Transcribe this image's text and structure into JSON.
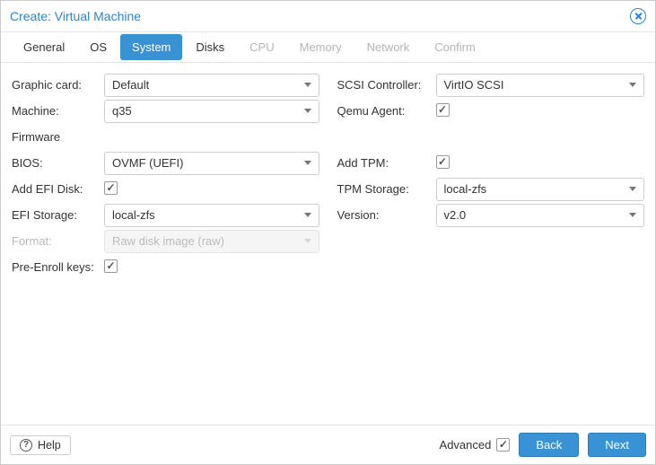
{
  "window": {
    "title": "Create: Virtual Machine"
  },
  "tabs": {
    "general": "General",
    "os": "OS",
    "system": "System",
    "disks": "Disks",
    "cpu": "CPU",
    "memory": "Memory",
    "network": "Network",
    "confirm": "Confirm"
  },
  "labels": {
    "graphic_card": "Graphic card:",
    "machine": "Machine:",
    "firmware": "Firmware",
    "bios": "BIOS:",
    "add_efi_disk": "Add EFI Disk:",
    "efi_storage": "EFI Storage:",
    "format": "Format:",
    "pre_enroll": "Pre-Enroll keys:",
    "scsi_controller": "SCSI Controller:",
    "qemu_agent": "Qemu Agent:",
    "add_tpm": "Add TPM:",
    "tpm_storage": "TPM Storage:",
    "version": "Version:"
  },
  "values": {
    "graphic_card": "Default",
    "machine": "q35",
    "bios": "OVMF (UEFI)",
    "add_efi_disk": true,
    "efi_storage": "local-zfs",
    "format_placeholder": "Raw disk image (raw)",
    "pre_enroll": true,
    "scsi_controller": "VirtIO SCSI",
    "qemu_agent": true,
    "add_tpm": true,
    "tpm_storage": "local-zfs",
    "version": "v2.0"
  },
  "footer": {
    "help": "Help",
    "advanced": "Advanced",
    "advanced_checked": true,
    "back": "Back",
    "next": "Next"
  }
}
